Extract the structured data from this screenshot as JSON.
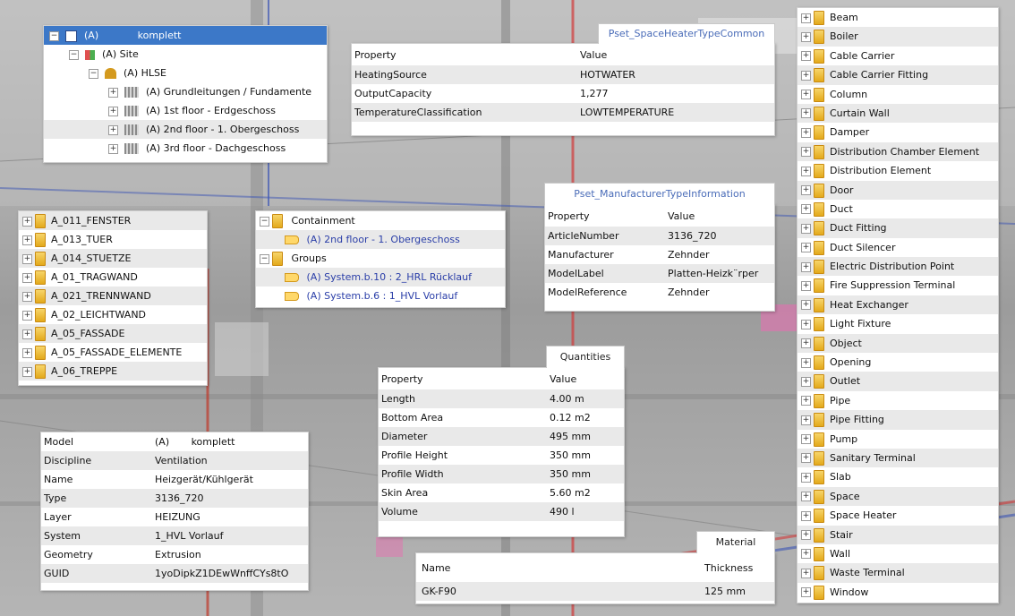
{
  "tree": {
    "root": {
      "label": "(A)",
      "name": "komplett"
    },
    "items": [
      {
        "label": "(A) Site"
      },
      {
        "label": "(A) HLSE"
      },
      {
        "label": "(A) Grundleitungen / Fundamente"
      },
      {
        "label": "(A) 1st floor - Erdgeschoss"
      },
      {
        "label": "(A) 2nd floor - 1. Obergeschoss"
      },
      {
        "label": "(A) 3rd floor - Dachgeschoss"
      }
    ]
  },
  "layers": {
    "items": [
      "A_011_FENSTER",
      "A_013_TUER",
      "A_014_STUETZE",
      "A_01_TRAGWAND",
      "A_021_TRENNWAND",
      "A_02_LEICHTWAND",
      "A_05_FASSADE",
      "A_05_FASSADE_ELEMENTE",
      "A_06_TREPPE"
    ]
  },
  "relations": {
    "containment_label": "Containment",
    "containment_item": "(A) 2nd floor - 1. Obergeschoss",
    "groups_label": "Groups",
    "group_items": [
      "(A) System.b.10 : 2_HRL Rücklauf",
      "(A) System.b.6 : 1_HVL Vorlauf"
    ]
  },
  "pset_heater": {
    "tab": "Pset_SpaceHeaterTypeCommon",
    "headers": [
      "Property",
      "Value"
    ],
    "rows": [
      [
        "HeatingSource",
        "HOTWATER"
      ],
      [
        "OutputCapacity",
        "1,277"
      ],
      [
        "TemperatureClassification",
        "LOWTEMPERATURE"
      ]
    ]
  },
  "pset_manufacturer": {
    "tab": "Pset_ManufacturerTypeInformation",
    "headers": [
      "Property",
      "Value"
    ],
    "rows": [
      [
        "ArticleNumber",
        "3136_720"
      ],
      [
        "Manufacturer",
        "Zehnder"
      ],
      [
        "ModelLabel",
        "Platten-Heizk¨rper"
      ],
      [
        "ModelReference",
        "Zehnder"
      ]
    ]
  },
  "quantities": {
    "tab": "Quantities",
    "headers": [
      "Property",
      "Value"
    ],
    "rows": [
      [
        "Length",
        "4.00 m"
      ],
      [
        "Bottom Area",
        "0.12 m2"
      ],
      [
        "Diameter",
        "495 mm"
      ],
      [
        "Profile Height",
        "350 mm"
      ],
      [
        "Profile Width",
        "350 mm"
      ],
      [
        "Skin Area",
        "5.60 m2"
      ],
      [
        "Volume",
        "490 l"
      ]
    ]
  },
  "material": {
    "tab": "Material",
    "headers": [
      "Name",
      "Thickness"
    ],
    "rows": [
      [
        "GK-F90",
        "125 mm"
      ]
    ]
  },
  "properties": {
    "rows": [
      [
        "Model",
        "(A)       komplett"
      ],
      [
        "Discipline",
        "Ventilation"
      ],
      [
        "Name",
        "Heizgerät/Kühlgerät"
      ],
      [
        "Type",
        "3136_720"
      ],
      [
        "Layer",
        "HEIZUNG"
      ],
      [
        "System",
        "1_HVL Vorlauf"
      ],
      [
        "Geometry",
        "Extrusion"
      ],
      [
        "GUID",
        "1yoDipkZ1DEwWnffCYs8tO"
      ]
    ]
  },
  "types": {
    "items": [
      "Beam",
      "Boiler",
      "Cable Carrier",
      "Cable Carrier Fitting",
      "Column",
      "Curtain Wall",
      "Damper",
      "Distribution Chamber Element",
      "Distribution Element",
      "Door",
      "Duct",
      "Duct Fitting",
      "Duct Silencer",
      "Electric Distribution Point",
      "Fire Suppression Terminal",
      "Heat Exchanger",
      "Light Fixture",
      "Object",
      "Opening",
      "Outlet",
      "Pipe",
      "Pipe Fitting",
      "Pump",
      "Sanitary Terminal",
      "Slab",
      "Space",
      "Space Heater",
      "Stair",
      "Wall",
      "Waste Terminal",
      "Window"
    ]
  }
}
